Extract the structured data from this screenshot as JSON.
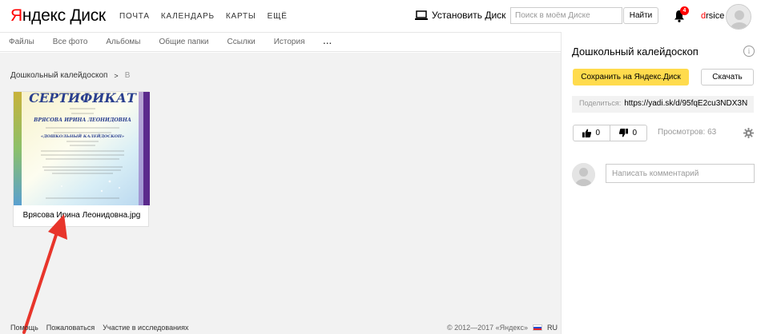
{
  "header": {
    "logo_ya": "Я",
    "logo_rest": "ндекс Диск",
    "nav": [
      "ПОЧТА",
      "КАЛЕНДАРЬ",
      "КАРТЫ",
      "ЕЩЁ"
    ],
    "install_label": "Установить Диск",
    "search_placeholder": "Поиск в моём Диске",
    "search_button": "Найти",
    "notifications_count": "4",
    "username_first": "d",
    "username_rest": "rsice"
  },
  "tabs": [
    "Файлы",
    "Все фото",
    "Альбомы",
    "Общие папки",
    "Ссылки",
    "История",
    "..."
  ],
  "breadcrumb": {
    "folder": "Дошкольный калейдоскоп",
    "separator": ">",
    "current": "В"
  },
  "file": {
    "name": "Врясова Ирина Леонидовна.jpg",
    "thumb_title": "СЕРТИФИКАТ",
    "thumb_name": "ВРЯСОВА ИРИНА ЛЕОНИДОВНА",
    "thumb_project": "«ДОШКОЛЬНЫЙ КАЛЕЙДОСКОП»"
  },
  "footer": {
    "links": [
      "Помощь",
      "Пожаловаться",
      "Участие в исследованиях"
    ],
    "copyright": "© 2012—2017 «Яндекс»",
    "lang": "RU"
  },
  "sidebar": {
    "title": "Дошкольный калейдоскоп",
    "info_icon": "i",
    "save_label": "Сохранить на Яндекс.Диск",
    "download_label": "Скачать",
    "share_label": "Поделиться:",
    "share_url": "https://yadi.sk/d/95fqE2cu3NDX3N",
    "likes": "0",
    "dislikes": "0",
    "views_label": "Просмотров: 63",
    "comment_placeholder": "Написать комментарий"
  },
  "colors": {
    "accent_yellow": "#ffdb4d",
    "brand_red": "#ff0000",
    "annotation_arrow": "#e8352b",
    "content_bg": "#f2f2f2"
  }
}
